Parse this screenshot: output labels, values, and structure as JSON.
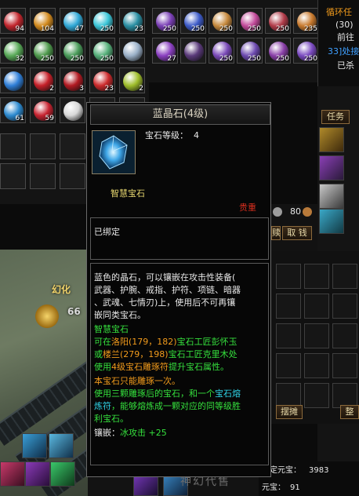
{
  "bag_left": {
    "rows": [
      [
        {
          "icon": "red-gem-icon",
          "count": "94",
          "color": "#c2262d"
        },
        {
          "icon": "amber-gem-icon",
          "count": "104",
          "color": "#d28a1e"
        },
        {
          "icon": "blue-orb-icon",
          "count": "47",
          "color": "#31a9d7"
        },
        {
          "icon": "cyan-orb-icon",
          "count": "250",
          "color": "#3bc6d8"
        },
        {
          "icon": "teal-orb-icon",
          "count": "23",
          "color": "#2a8fa3"
        }
      ],
      [
        {
          "icon": "green-jade-icon",
          "count": "32",
          "color": "#58a957"
        },
        {
          "icon": "green-jade-icon",
          "count": "250",
          "color": "#4e9a4c"
        },
        {
          "icon": "green-jade-icon",
          "count": "250",
          "color": "#4a9c5a"
        },
        {
          "icon": "green-jade-icon",
          "count": "250",
          "color": "#56b07a"
        },
        {
          "icon": "potion-icon",
          "count": "",
          "color": "#9ab0c8"
        }
      ],
      [
        {
          "icon": "blue-crystal-icon",
          "count": "",
          "color": "#2f7fd8"
        },
        {
          "icon": "red-gem-icon",
          "count": "2",
          "color": "#c52029"
        },
        {
          "icon": "red-crystal-icon",
          "count": "3",
          "color": "#b21a22"
        },
        {
          "icon": "red-crystal-icon",
          "count": "23",
          "color": "#cc2a2c"
        },
        {
          "icon": "yellow-green-gem-icon",
          "count": "2",
          "color": "#9fbd2b"
        }
      ],
      [
        {
          "icon": "blue-crystal-icon",
          "count": "61",
          "color": "#2c8ad0"
        },
        {
          "icon": "red-gem-icon",
          "count": "59",
          "color": "#c72330"
        },
        {
          "icon": "white-fang-icon",
          "count": "",
          "color": "#d8d8d8"
        },
        {
          "icon": "empty-slot",
          "count": "",
          "color": ""
        },
        {
          "icon": "empty-slot",
          "count": "",
          "color": ""
        }
      ]
    ]
  },
  "bag_right": {
    "rows": [
      [
        {
          "icon": "purple-orb-icon",
          "count": "250",
          "color": "#7a3fb5"
        },
        {
          "icon": "blue-orb-icon",
          "count": "250",
          "color": "#3d5bc8"
        },
        {
          "icon": "lamp-icon",
          "count": "250",
          "color": "#c78a3e"
        },
        {
          "icon": "pink-orb-icon",
          "count": "250",
          "color": "#c24a9a"
        },
        {
          "icon": "red-orb-icon",
          "count": "250",
          "color": "#b23c4a"
        },
        {
          "icon": "orange-orb-icon",
          "count": "235",
          "color": "#c87a2e"
        }
      ],
      [
        {
          "icon": "purple-rune-icon",
          "count": "27",
          "color": "#8a3fc0"
        },
        {
          "icon": "dark-orb-icon",
          "count": "",
          "color": "#5a3a7a"
        },
        {
          "icon": "purple-orb-icon",
          "count": "250",
          "color": "#7a4ab8"
        },
        {
          "icon": "purple-orb-icon",
          "count": "250",
          "color": "#6d4ab0"
        },
        {
          "icon": "purple-orb-icon",
          "count": "250",
          "color": "#8a3fa8"
        },
        {
          "icon": "purple-orb-icon",
          "count": "250",
          "color": "#7a4ac0"
        }
      ]
    ]
  },
  "quest_panel": {
    "title": "循环任",
    "lines": [
      "(30)",
      "前往",
      "33]处接",
      "已杀"
    ],
    "tab": "任务"
  },
  "tooltip": {
    "title": "蓝晶石(4级)",
    "gem_level_label": "宝石等级：",
    "gem_level_value": "4",
    "item_type": "智慧宝石",
    "sale_tag": "贵重",
    "bound": "已绑定",
    "desc_lines": [
      "蓝色的晶石，可以镶嵌在攻击性装备(",
      "武器、护腕、戒指、护符、项链、暗器",
      "、武魂、七情刃)上，使用后不可再镶",
      "嵌同类宝石。"
    ],
    "wisdom_label": "智慧宝石",
    "loc1_pre": "可在",
    "loc1_place": "洛阳",
    "loc1_coords": "(179，182)",
    "loc1_post": "宝石工匠彭怀玉",
    "loc2_pre": "或",
    "loc2_place": "楼兰",
    "loc2_coords": "(279，198)",
    "loc2_post": "宝石工匠克里木处",
    "loc3_pre": "使用",
    "loc3_item": "4级宝石雕琢符",
    "loc3_post": "提升宝石属性。",
    "carve_once": "本宝石只能雕琢一次。",
    "fuse_pre": "使用三颗雕琢后的宝石，和一个",
    "fuse_item1": "宝石熔",
    "fuse_item2": "炼符",
    "fuse_post": "，能够熔炼成一颗对应的同等级胜",
    "fuse_end": "利宝石。",
    "inlay_label": "镶嵌：",
    "inlay_value": "冰攻击 +25"
  },
  "shop": {
    "money": "80",
    "buttons": [
      "赎",
      "取 钱"
    ],
    "stall_button": "摆摊",
    "sort_button": "整"
  },
  "status": {
    "bound_yuanbao_label": "绑定元宝：",
    "bound_yuanbao_value": "3983",
    "yuanbao_label": "元宝：",
    "yuanbao_value": "91"
  },
  "world": {
    "effect_text": "幻化",
    "effect_number": "66"
  },
  "watermark": "神幻代售"
}
